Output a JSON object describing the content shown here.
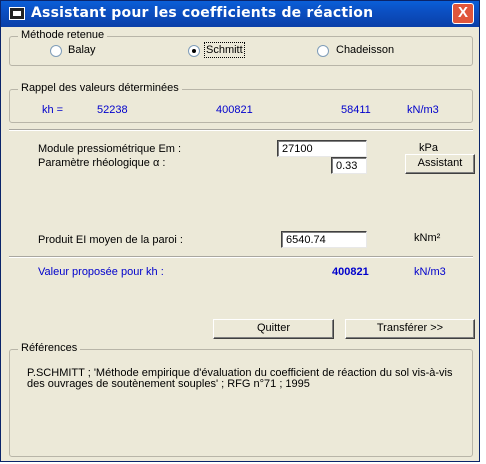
{
  "window": {
    "title": "Assistant pour les coefficients de réaction",
    "close_label": "X"
  },
  "methode": {
    "label": "Méthode retenue",
    "options": [
      {
        "label": "Balay",
        "checked": false
      },
      {
        "label": "Schmitt",
        "checked": true
      },
      {
        "label": "Chadeisson",
        "checked": false
      }
    ]
  },
  "rappel": {
    "label": "Rappel des valeurs déterminées",
    "kh_label": "kh =",
    "values": [
      "52238",
      "400821",
      "58411"
    ],
    "unit": "kN/m3"
  },
  "params": {
    "module_label": "Module pressiométrique Em :",
    "module_value": "27100",
    "module_unit": "kPa",
    "rheo_label": "Paramètre rhéologique α :",
    "rheo_value": "0.33",
    "assistant_label": "Assistant",
    "produit_label": "Produit EI moyen de la paroi :",
    "produit_value": "6540.74",
    "produit_unit": "kNm²"
  },
  "proposition": {
    "label": "Valeur proposée pour kh :",
    "value": "400821",
    "unit": "kN/m3"
  },
  "buttons": {
    "quitter": "Quitter",
    "transferer": "Transférer >>"
  },
  "references": {
    "label": "Références",
    "text": "P.SCHMITT ; 'Méthode empirique d'évaluation du coefficient de réaction du sol vis-à-vis des ouvrages de soutènement souples' ; RFG n°71 ; 1995"
  }
}
